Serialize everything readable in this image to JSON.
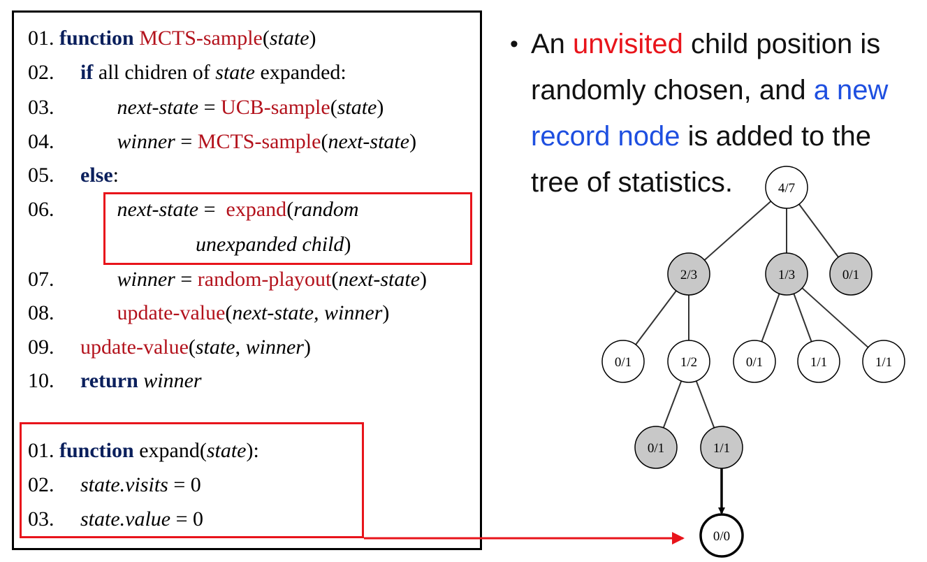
{
  "code": {
    "mcts": [
      {
        "num": "01.",
        "parts": [
          {
            "t": " "
          },
          {
            "t": "function",
            "s": "kw"
          },
          {
            "t": " "
          },
          {
            "t": "MCTS-sample",
            "s": "fn"
          },
          {
            "t": "("
          },
          {
            "t": "state",
            "s": "i"
          },
          {
            "t": ")"
          }
        ]
      },
      {
        "num": "02.",
        "parts": [
          {
            "t": "     "
          },
          {
            "t": "if",
            "s": "kw"
          },
          {
            "t": " all chidren of "
          },
          {
            "t": "state",
            "s": "i"
          },
          {
            "t": " expanded:"
          }
        ]
      },
      {
        "num": "03.",
        "parts": [
          {
            "t": "            "
          },
          {
            "t": "next-state",
            "s": "i"
          },
          {
            "t": " = "
          },
          {
            "t": "UCB-sample",
            "s": "fn"
          },
          {
            "t": "("
          },
          {
            "t": "state",
            "s": "i"
          },
          {
            "t": ")"
          }
        ]
      },
      {
        "num": "04.",
        "parts": [
          {
            "t": "            "
          },
          {
            "t": "winner",
            "s": "i"
          },
          {
            "t": " = "
          },
          {
            "t": "MCTS-sample",
            "s": "fn"
          },
          {
            "t": "("
          },
          {
            "t": "next-state",
            "s": "i"
          },
          {
            "t": ")"
          }
        ]
      },
      {
        "num": "05.",
        "parts": [
          {
            "t": "     "
          },
          {
            "t": "else",
            "s": "kw"
          },
          {
            "t": ":"
          }
        ]
      },
      {
        "num": "06.",
        "parts": [
          {
            "t": "            "
          },
          {
            "t": "next-state",
            "s": "i"
          },
          {
            "t": " =  "
          },
          {
            "t": "expand",
            "s": "fn"
          },
          {
            "t": "("
          },
          {
            "t": "random",
            "s": "i"
          }
        ]
      },
      {
        "num": "",
        "parts": [
          {
            "t": "                             "
          },
          {
            "t": "unexpanded child",
            "s": "i"
          },
          {
            "t": ")"
          }
        ]
      },
      {
        "num": "07.",
        "parts": [
          {
            "t": "            "
          },
          {
            "t": "winner",
            "s": "i"
          },
          {
            "t": " = "
          },
          {
            "t": "random-playout",
            "s": "fn"
          },
          {
            "t": "("
          },
          {
            "t": "next-state",
            "s": "i"
          },
          {
            "t": ")"
          }
        ]
      },
      {
        "num": "08.",
        "parts": [
          {
            "t": "            "
          },
          {
            "t": "update-value",
            "s": "fn"
          },
          {
            "t": "("
          },
          {
            "t": "next-state, winner",
            "s": "i"
          },
          {
            "t": ")"
          }
        ]
      },
      {
        "num": "09.",
        "parts": [
          {
            "t": "     "
          },
          {
            "t": "update-value",
            "s": "fn"
          },
          {
            "t": "("
          },
          {
            "t": "state",
            "s": "i"
          },
          {
            "t": ", "
          },
          {
            "t": "winner",
            "s": "i"
          },
          {
            "t": ")"
          }
        ]
      },
      {
        "num": "10.",
        "parts": [
          {
            "t": "     "
          },
          {
            "t": "return",
            "s": "kw"
          },
          {
            "t": " "
          },
          {
            "t": "winner",
            "s": "i"
          }
        ]
      }
    ],
    "expand": [
      {
        "num": "01.",
        "parts": [
          {
            "t": " "
          },
          {
            "t": "function",
            "s": "kw"
          },
          {
            "t": " expand("
          },
          {
            "t": "state",
            "s": "i"
          },
          {
            "t": "):"
          }
        ]
      },
      {
        "num": "02.",
        "parts": [
          {
            "t": "     "
          },
          {
            "t": "state.visits",
            "s": "i"
          },
          {
            "t": " = 0"
          }
        ]
      },
      {
        "num": "03.",
        "parts": [
          {
            "t": "     "
          },
          {
            "t": "state.value",
            "s": "i"
          },
          {
            "t": " = 0"
          }
        ]
      }
    ]
  },
  "bullet": {
    "dot": "•",
    "parts": [
      {
        "t": "An "
      },
      {
        "t": "unvisited",
        "s": "red"
      },
      {
        "t": " child position is randomly chosen, and "
      },
      {
        "t": "a new record node",
        "s": "blue"
      },
      {
        "t": " is added to the tree of statistics."
      }
    ]
  },
  "tree": {
    "nodes": [
      {
        "id": "root",
        "label": "4/7",
        "shaded": false
      },
      {
        "id": "a",
        "label": "2/3",
        "shaded": true
      },
      {
        "id": "b",
        "label": "1/3",
        "shaded": true
      },
      {
        "id": "c",
        "label": "0/1",
        "shaded": true
      },
      {
        "id": "a1",
        "label": "0/1",
        "shaded": false
      },
      {
        "id": "a2",
        "label": "1/2",
        "shaded": false
      },
      {
        "id": "b1",
        "label": "0/1",
        "shaded": false
      },
      {
        "id": "b2",
        "label": "1/1",
        "shaded": false
      },
      {
        "id": "b3",
        "label": "1/1",
        "shaded": false
      },
      {
        "id": "a2a",
        "label": "0/1",
        "shaded": true
      },
      {
        "id": "a2b",
        "label": "1/1",
        "shaded": true
      },
      {
        "id": "new",
        "label": "0/0",
        "shaded": false,
        "bold": true
      }
    ],
    "edges": [
      [
        "root",
        "a"
      ],
      [
        "root",
        "b"
      ],
      [
        "root",
        "c"
      ],
      [
        "a",
        "a1"
      ],
      [
        "a",
        "a2"
      ],
      [
        "b",
        "b1"
      ],
      [
        "b",
        "b2"
      ],
      [
        "b",
        "b3"
      ],
      [
        "a2",
        "a2a"
      ],
      [
        "a2",
        "a2b"
      ]
    ],
    "arrow_edge": [
      "a2b",
      "new"
    ],
    "colors": {
      "shaded": "#c8c8c8",
      "plain": "#ffffff",
      "highlight": "#e8141b"
    }
  }
}
